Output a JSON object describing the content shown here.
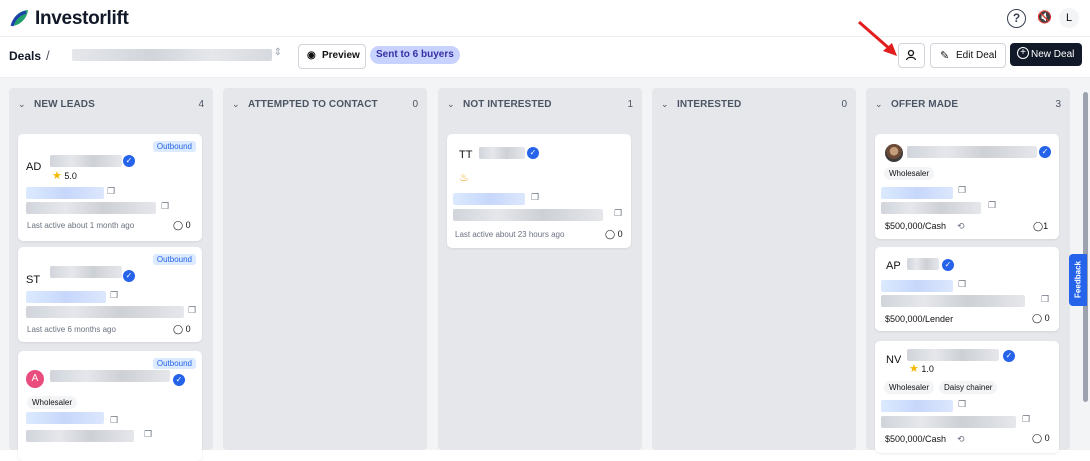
{
  "app": {
    "brand": "Investorlift",
    "help": "?",
    "mute": "🔇",
    "user_initial": "L"
  },
  "header": {
    "breadcrumb": "Deals",
    "separator": "/",
    "preview_label": "Preview",
    "sent_badge": "Sent to 6 buyers",
    "edit_label": "Edit Deal",
    "new_label": "New Deal"
  },
  "feedback_label": "Feedback",
  "colors": {
    "accent": "#2563eb",
    "badge_bg": "#c7d2fe",
    "dark_button": "#111827"
  },
  "columns": [
    {
      "title": "NEW LEADS",
      "count": "4"
    },
    {
      "title": "ATTEMPTED TO CONTACT",
      "count": "0"
    },
    {
      "title": "NOT INTERESTED",
      "count": "1"
    },
    {
      "title": "INTERESTED",
      "count": "0"
    },
    {
      "title": "OFFER MADE",
      "count": "3"
    }
  ],
  "cards": {
    "c1": {
      "initials": "AD",
      "badge": "Outbound",
      "rating": "5.0",
      "active": "Last active about 1 month ago",
      "comments": "0"
    },
    "c2": {
      "initials": "ST",
      "badge": "Outbound",
      "active": "Last active 6 months ago",
      "comments": "0"
    },
    "c3": {
      "initials": "A",
      "badge": "Outbound",
      "tag": "Wholesaler"
    },
    "n1": {
      "initials": "TT",
      "active": "Last active about 23 hours ago",
      "comments": "0"
    },
    "o1": {
      "tag": "Wholesaler",
      "price": "$500,000/Cash",
      "comments": "1"
    },
    "o2": {
      "initials": "AP",
      "price": "$500,000/Lender",
      "comments": "0"
    },
    "o3": {
      "initials": "NV",
      "rating": "1.0",
      "tag1": "Wholesaler",
      "tag2": "Daisy chainer",
      "price": "$500,000/Cash",
      "comments": "0"
    }
  },
  "icons": {
    "chevron": "chevron-down-icon",
    "verified": "verified-icon",
    "clipboard": "clipboard-icon",
    "comment": "comment-icon"
  }
}
